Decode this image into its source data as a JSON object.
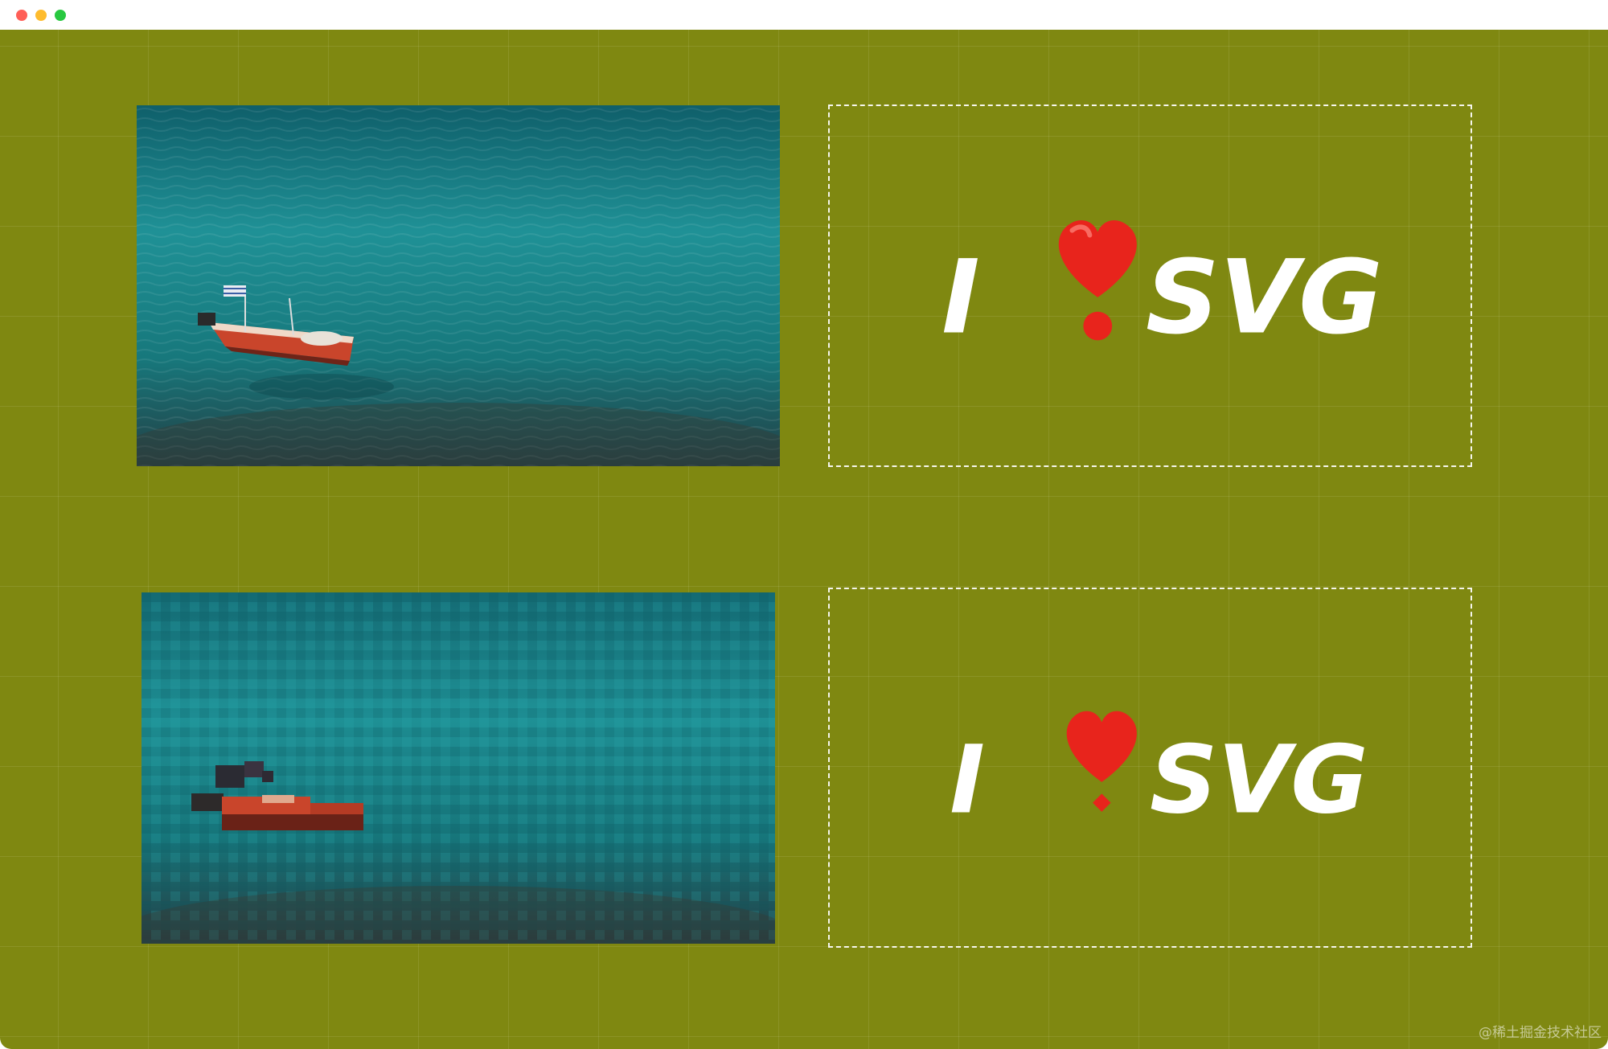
{
  "window": {
    "controls": [
      "close",
      "minimize",
      "maximize"
    ]
  },
  "demos": [
    {
      "photo": {
        "subject": "red-boat-on-turquoise-sea",
        "effect": "none"
      },
      "text": {
        "before": "I",
        "icon": "heart-exclamation-icon",
        "after": "SVG"
      }
    },
    {
      "photo": {
        "subject": "red-boat-on-turquoise-sea",
        "effect": "pixelated"
      },
      "text": {
        "before": "I",
        "icon": "heart-exclamation-icon",
        "after": "SVG"
      }
    }
  ],
  "watermark": "@稀土掘金技术社区",
  "colors": {
    "canvas": "#7f8811",
    "sea": "#1f8f93",
    "boat": "#c9452b",
    "heart": "#e8241c",
    "text": "#ffffff"
  }
}
